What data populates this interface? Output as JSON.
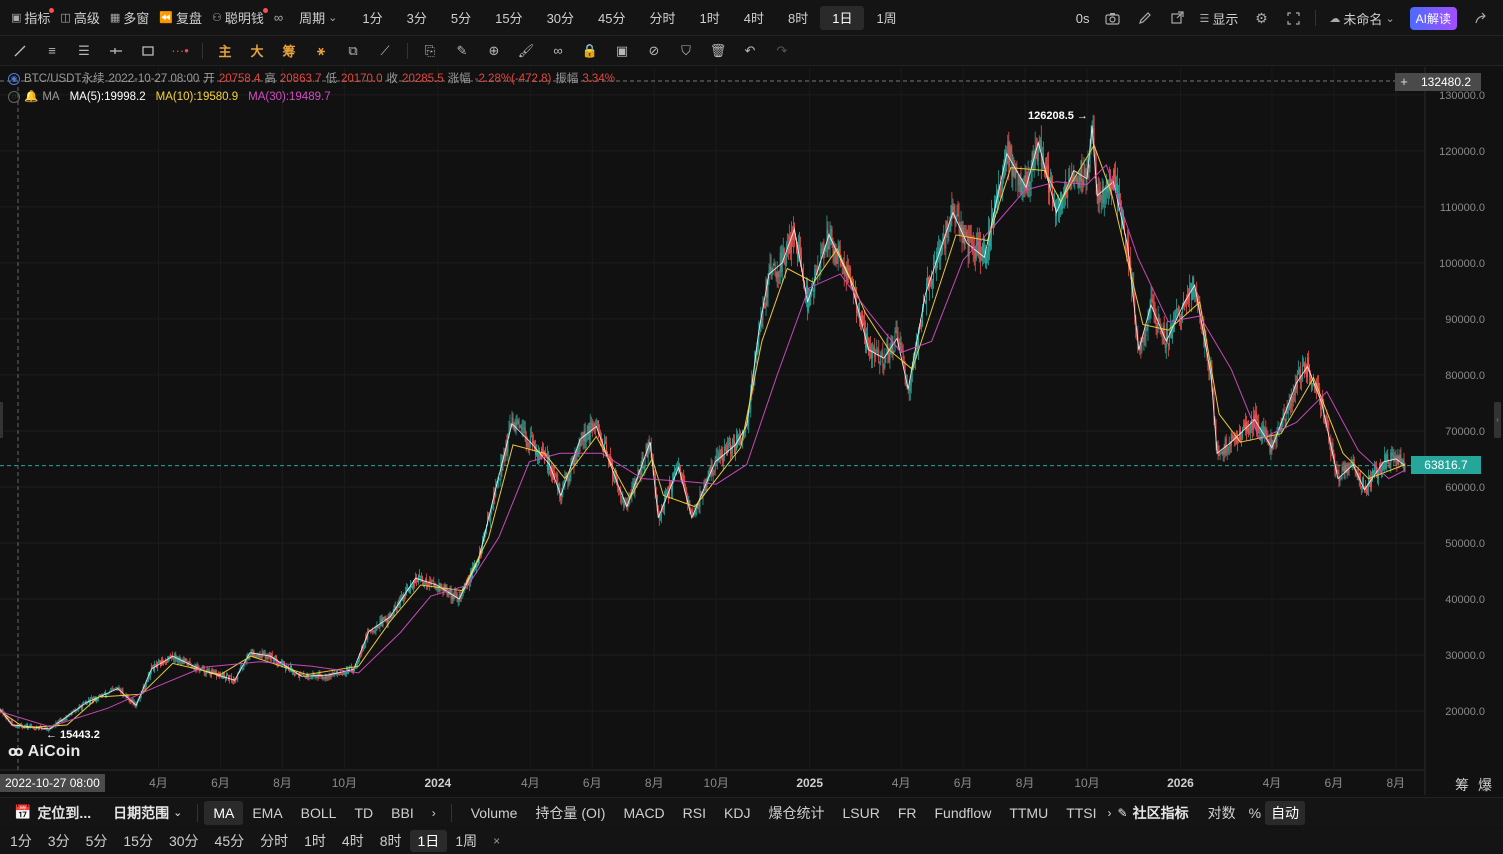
{
  "top_toolbar": {
    "left_items": [
      {
        "label": "指标",
        "icon": "chart-box-icon",
        "dot": true
      },
      {
        "label": "高级",
        "icon": "layout-icon",
        "dot": false
      },
      {
        "label": "多窗",
        "icon": "grid-icon",
        "dot": false
      },
      {
        "label": "复盘",
        "icon": "rewind-icon",
        "dot": false
      },
      {
        "label": "聪明钱",
        "icon": "smart-money-icon",
        "dot": true
      }
    ],
    "period_dropdown": "周期",
    "periods": [
      "1分",
      "3分",
      "5分",
      "15分",
      "30分",
      "45分",
      "分时",
      "1时",
      "4时",
      "8时",
      "1日",
      "1周"
    ],
    "active_period": "1日",
    "right": {
      "countdown": "0s",
      "display_label": "显示",
      "workspace_name": "未命名",
      "ai_label": "AI解读"
    }
  },
  "legend": {
    "symbol": "BTC/USDT永续",
    "datetime": "2022-10-27 08:00",
    "open_label": "开",
    "open": "20758.4",
    "high_label": "高",
    "high": "20863.7",
    "low_label": "低",
    "low": "20170.0",
    "close_label": "收",
    "close": "20285.5",
    "change_label": "涨幅",
    "change": "-2.28%(-472.8)",
    "amp_label": "振幅",
    "amp": "3.34%",
    "ma_name": "MA",
    "ma5": "MA(5):19998.2",
    "ma10": "MA(10):19580.9",
    "ma30": "MA(30):19489.7"
  },
  "colors": {
    "up": "#26a69a",
    "down": "#ef5350",
    "ma5": "#ffffff",
    "ma10": "#f5d33a",
    "ma30": "#d14cc2",
    "current_price_bg": "#26a69a",
    "crosshair_price_bg": "#4a4a4a"
  },
  "crosshair": {
    "price": "132480.2",
    "time": "2022-10-27 08:00"
  },
  "current_price": "63816.7",
  "annotations": {
    "high_marker": "126208.5 →",
    "low_marker": "← 15443.2"
  },
  "logo_text": "AiCoin",
  "chart_data": {
    "type": "line",
    "title": "",
    "y_axis_ticks": [
      "130000.0",
      "120000.0",
      "110000.0",
      "100000.0",
      "90000.0",
      "80000.0",
      "70000.0",
      "60000.0",
      "50000.0",
      "40000.0",
      "30000.0",
      "20000.0"
    ],
    "ylim": [
      10000,
      132480
    ],
    "y_scale": "linear",
    "x_axis_ticks": [
      "4月",
      "6月",
      "8月",
      "10月",
      "2024",
      "4月",
      "6月",
      "8月",
      "10月",
      "2025",
      "4月",
      "6月",
      "8月",
      "10月",
      "2026",
      "4月",
      "6月",
      "8月"
    ],
    "x_range": [
      "2022-10-27",
      "2026-08-10"
    ],
    "grid": true,
    "series": [
      {
        "name": "MA(5)",
        "points": [
          [
            "2022-10-27",
            20300
          ],
          [
            "2022-11-08",
            17500
          ],
          [
            "2022-12-15",
            16800
          ],
          [
            "2023-01-20",
            21500
          ],
          [
            "2023-02-20",
            24000
          ],
          [
            "2023-03-10",
            21000
          ],
          [
            "2023-03-25",
            27500
          ],
          [
            "2023-04-15",
            29800
          ],
          [
            "2023-05-15",
            27200
          ],
          [
            "2023-06-15",
            25500
          ],
          [
            "2023-06-30",
            30400
          ],
          [
            "2023-07-20",
            29800
          ],
          [
            "2023-08-20",
            26200
          ],
          [
            "2023-09-15",
            26400
          ],
          [
            "2023-10-10",
            27400
          ],
          [
            "2023-10-25",
            34200
          ],
          [
            "2023-11-15",
            36800
          ],
          [
            "2023-12-10",
            43700
          ],
          [
            "2023-12-31",
            42500
          ],
          [
            "2024-01-22",
            40000
          ],
          [
            "2024-02-10",
            47000
          ],
          [
            "2024-02-28",
            60500
          ],
          [
            "2024-03-14",
            71300
          ],
          [
            "2024-04-01",
            68000
          ],
          [
            "2024-04-20",
            64000
          ],
          [
            "2024-05-01",
            58500
          ],
          [
            "2024-05-20",
            68500
          ],
          [
            "2024-06-05",
            70800
          ],
          [
            "2024-06-25",
            61000
          ],
          [
            "2024-07-05",
            56500
          ],
          [
            "2024-07-28",
            68000
          ],
          [
            "2024-08-05",
            54500
          ],
          [
            "2024-08-25",
            63500
          ],
          [
            "2024-09-07",
            54500
          ],
          [
            "2024-09-30",
            64500
          ],
          [
            "2024-10-20",
            67500
          ],
          [
            "2024-10-31",
            71000
          ],
          [
            "2024-11-12",
            88000
          ],
          [
            "2024-11-22",
            98000
          ],
          [
            "2024-12-05",
            100000
          ],
          [
            "2024-12-17",
            106000
          ],
          [
            "2024-12-30",
            93000
          ],
          [
            "2025-01-20",
            105000
          ],
          [
            "2025-02-10",
            97000
          ],
          [
            "2025-02-28",
            84500
          ],
          [
            "2025-03-15",
            83000
          ],
          [
            "2025-03-28",
            86500
          ],
          [
            "2025-04-08",
            77500
          ],
          [
            "2025-04-25",
            94500
          ],
          [
            "2025-05-22",
            109000
          ],
          [
            "2025-06-05",
            103500
          ],
          [
            "2025-06-22",
            101000
          ],
          [
            "2025-07-14",
            119500
          ],
          [
            "2025-08-02",
            113500
          ],
          [
            "2025-08-14",
            121500
          ],
          [
            "2025-09-01",
            109000
          ],
          [
            "2025-09-18",
            116500
          ],
          [
            "2025-10-01",
            115000
          ],
          [
            "2025-10-06",
            124500
          ],
          [
            "2025-10-11",
            112000
          ],
          [
            "2025-10-27",
            114500
          ],
          [
            "2025-11-10",
            103000
          ],
          [
            "2025-11-21",
            84500
          ],
          [
            "2025-12-03",
            92500
          ],
          [
            "2025-12-18",
            86000
          ],
          [
            "2026-01-05",
            93000
          ],
          [
            "2026-01-15",
            96000
          ],
          [
            "2026-01-31",
            80000
          ],
          [
            "2026-02-06",
            66000
          ],
          [
            "2026-02-20",
            68000
          ],
          [
            "2026-03-15",
            72000
          ],
          [
            "2026-04-01",
            67000
          ],
          [
            "2026-04-25",
            78500
          ],
          [
            "2026-05-06",
            81500
          ],
          [
            "2026-05-20",
            75000
          ],
          [
            "2026-06-05",
            61500
          ],
          [
            "2026-06-20",
            64000
          ],
          [
            "2026-07-01",
            59500
          ],
          [
            "2026-07-20",
            64500
          ],
          [
            "2026-08-01",
            65000
          ],
          [
            "2026-08-10",
            63817
          ]
        ]
      },
      {
        "name": "MA(10)",
        "points": [
          [
            "2022-10-27",
            20000
          ],
          [
            "2022-11-20",
            17000
          ],
          [
            "2023-01-01",
            17500
          ],
          [
            "2023-02-01",
            22500
          ],
          [
            "2023-03-15",
            23000
          ],
          [
            "2023-04-15",
            28500
          ],
          [
            "2023-06-01",
            26500
          ],
          [
            "2023-07-01",
            29800
          ],
          [
            "2023-08-25",
            26500
          ],
          [
            "2023-10-15",
            28000
          ],
          [
            "2023-11-15",
            36000
          ],
          [
            "2023-12-15",
            42500
          ],
          [
            "2024-01-25",
            41500
          ],
          [
            "2024-02-20",
            51000
          ],
          [
            "2024-03-15",
            67500
          ],
          [
            "2024-04-15",
            66000
          ],
          [
            "2024-05-05",
            61500
          ],
          [
            "2024-06-05",
            69000
          ],
          [
            "2024-07-08",
            58000
          ],
          [
            "2024-07-30",
            65000
          ],
          [
            "2024-08-10",
            58500
          ],
          [
            "2024-09-10",
            56500
          ],
          [
            "2024-10-25",
            67000
          ],
          [
            "2024-11-15",
            86000
          ],
          [
            "2024-12-10",
            99000
          ],
          [
            "2025-01-05",
            96500
          ],
          [
            "2025-01-28",
            102500
          ],
          [
            "2025-02-25",
            91000
          ],
          [
            "2025-03-20",
            84500
          ],
          [
            "2025-04-12",
            81000
          ],
          [
            "2025-05-25",
            105000
          ],
          [
            "2025-06-25",
            104000
          ],
          [
            "2025-07-18",
            117000
          ],
          [
            "2025-08-20",
            116500
          ],
          [
            "2025-09-05",
            111000
          ],
          [
            "2025-10-08",
            121000
          ],
          [
            "2025-10-25",
            112500
          ],
          [
            "2025-11-25",
            89000
          ],
          [
            "2025-12-20",
            88000
          ],
          [
            "2026-01-20",
            93000
          ],
          [
            "2026-02-08",
            73000
          ],
          [
            "2026-03-01",
            68000
          ],
          [
            "2026-04-10",
            69500
          ],
          [
            "2026-05-12",
            79500
          ],
          [
            "2026-06-10",
            66000
          ],
          [
            "2026-07-05",
            61500
          ],
          [
            "2026-08-10",
            64000
          ]
        ]
      },
      {
        "name": "MA(30)",
        "points": [
          [
            "2022-10-27",
            19900
          ],
          [
            "2022-12-15",
            17200
          ],
          [
            "2023-02-10",
            20500
          ],
          [
            "2023-04-01",
            24500
          ],
          [
            "2023-05-15",
            27800
          ],
          [
            "2023-07-10",
            28800
          ],
          [
            "2023-08-30",
            28000
          ],
          [
            "2023-10-15",
            26800
          ],
          [
            "2023-11-25",
            34000
          ],
          [
            "2023-12-25",
            40500
          ],
          [
            "2024-01-31",
            42500
          ],
          [
            "2024-03-01",
            51000
          ],
          [
            "2024-03-31",
            64500
          ],
          [
            "2024-04-30",
            66000
          ],
          [
            "2024-06-10",
            66000
          ],
          [
            "2024-07-20",
            61500
          ],
          [
            "2024-08-31",
            61000
          ],
          [
            "2024-10-01",
            60500
          ],
          [
            "2024-10-31",
            64000
          ],
          [
            "2024-11-30",
            80000
          ],
          [
            "2024-12-31",
            95500
          ],
          [
            "2025-01-31",
            98000
          ],
          [
            "2025-03-01",
            91000
          ],
          [
            "2025-04-01",
            84000
          ],
          [
            "2025-05-01",
            86000
          ],
          [
            "2025-06-01",
            100500
          ],
          [
            "2025-07-01",
            106500
          ],
          [
            "2025-08-01",
            113000
          ],
          [
            "2025-09-01",
            114500
          ],
          [
            "2025-10-01",
            114000
          ],
          [
            "2025-10-20",
            117500
          ],
          [
            "2025-11-20",
            101000
          ],
          [
            "2025-12-20",
            89500
          ],
          [
            "2026-01-20",
            90500
          ],
          [
            "2026-02-20",
            81000
          ],
          [
            "2026-03-20",
            68500
          ],
          [
            "2026-04-25",
            71500
          ],
          [
            "2026-05-25",
            77000
          ],
          [
            "2026-06-25",
            66500
          ],
          [
            "2026-07-25",
            61500
          ],
          [
            "2026-08-10",
            63000
          ]
        ]
      }
    ]
  },
  "bottom_bar": {
    "locate_label": "定位到...",
    "range_label": "日期范围",
    "main_indicators": [
      "MA",
      "EMA",
      "BOLL",
      "TD",
      "BBI"
    ],
    "active_main": "MA",
    "sub_indicators": [
      "Volume",
      "持仓量 (OI)",
      "MACD",
      "RSI",
      "KDJ",
      "爆仓统计",
      "LSUR",
      "FR",
      "Fundflow",
      "TTMU",
      "TTSI"
    ],
    "community_label": "社区指标",
    "log_label": "对数",
    "percent_label": "%",
    "auto_label": "自动",
    "right_corner": [
      "筹",
      "爆"
    ]
  },
  "period_bar": {
    "periods": [
      "1分",
      "3分",
      "5分",
      "15分",
      "30分",
      "45分",
      "分时",
      "1时",
      "4时",
      "8时",
      "1日",
      "1周"
    ],
    "active": "1日",
    "close_symbol": "×"
  }
}
